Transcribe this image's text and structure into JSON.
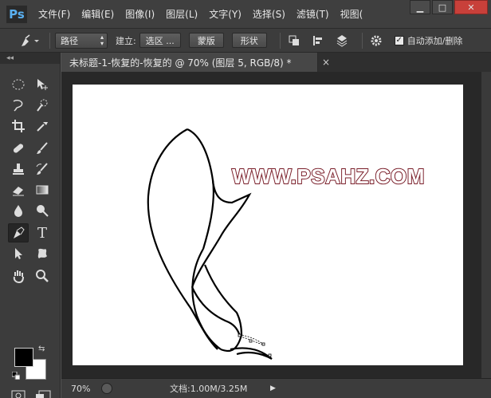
{
  "app": {
    "logo": "Ps"
  },
  "menu": [
    "文件(F)",
    "编辑(E)",
    "图像(I)",
    "图层(L)",
    "文字(Y)",
    "选择(S)",
    "滤镜(T)",
    "视图("
  ],
  "window_controls": {
    "minimize": "▁",
    "maximize": "□",
    "close": "✕"
  },
  "options": {
    "mode_select": "路径",
    "create_label": "建立:",
    "selection_button": "选区 ...",
    "mask_button": "蒙版",
    "shape_button": "形状",
    "auto_add_delete_label": "自动添加/删除",
    "auto_add_delete_checked": true
  },
  "toolbox": {
    "collapse": "◂◂",
    "tools": [
      "ellipse-marquee-icon",
      "move-icon",
      "lasso-icon",
      "quick-select-icon",
      "crop-icon",
      "eyedropper-icon",
      "healing-brush-icon",
      "brush-icon",
      "clone-stamp-icon",
      "history-brush-icon",
      "eraser-icon",
      "gradient-icon",
      "blur-icon",
      "dodge-icon",
      "pen-icon",
      "type-icon",
      "path-select-icon",
      "custom-shape-icon",
      "hand-icon",
      "zoom-icon"
    ],
    "type_glyph": "T",
    "active_tool": "pen-icon",
    "foreground_color": "#000000",
    "background_color": "#ffffff"
  },
  "document": {
    "tab_title": "未标题-1-恢复的-恢复的 @ 70% (图层 5, RGB/8) *",
    "tab_close": "×",
    "watermark": "WWW.PSAHZ.COM"
  },
  "status": {
    "zoom": "70%",
    "doc_size": "文档:1.00M/3.25M"
  },
  "colors": {
    "watermark_fill": "#ffffff",
    "watermark_stroke": "#7a1f2a",
    "path_stroke": "#000000"
  }
}
